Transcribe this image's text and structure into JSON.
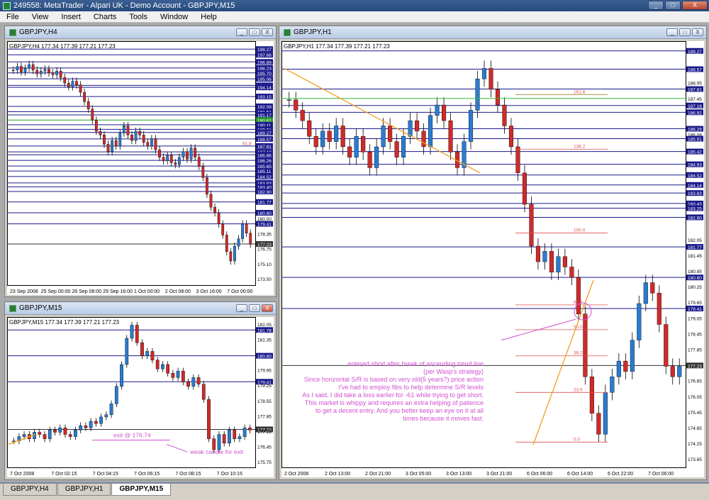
{
  "window": {
    "title": "249558: MetaTrader - Alpari UK - Demo Account - GBPJPY,M15",
    "min": "_",
    "max": "□",
    "close": "X"
  },
  "menu": [
    "File",
    "View",
    "Insert",
    "Charts",
    "Tools",
    "Window",
    "Help"
  ],
  "h4": {
    "caption": "GBPJPY,H4",
    "header": "GBPJPY,H4  177.34 177.39 177.21 177.23",
    "price_labels": [
      "198.27",
      "197.66",
      "196.89",
      "196.23",
      "195.70",
      "195.06",
      "194.35",
      "194.14",
      "193.15",
      "192.09",
      "191.51",
      "191.17",
      "190.61",
      "190.11",
      "189.61",
      "189.27",
      "188.57",
      "187.81",
      "187.18",
      "186.86",
      "186.26",
      "185.65",
      "185.11",
      "184.52",
      "183.83",
      "183.40",
      "182.90",
      "181.77",
      "180.60",
      "180.00",
      "179.41",
      "178.35",
      "177.23",
      "176.75",
      "175.10",
      "173.50"
    ],
    "fib_label": "61.8",
    "time_labels": [
      "23 Sep 2008",
      "25 Sep 00:00",
      "26 Sep 08:00",
      "29 Sep 16:00",
      "1 Oct 00:00",
      "2 Oct 08:00",
      "3 Oct 16:00",
      "7 Oct 00:00"
    ]
  },
  "m15": {
    "caption": "GBPJPY,M15",
    "header": "GBPJPY,M15  177.34 177.39 177.21 177.23",
    "price_labels": [
      "182.05",
      "181.78",
      "181.35",
      "180.65",
      "180.60",
      "179.95",
      "179.41",
      "179.25",
      "178.55",
      "177.85",
      "177.23",
      "177.15",
      "176.45",
      "175.75"
    ],
    "annotation_exit": "exit @ 176.74",
    "annotation_candle": "weak candle for exit",
    "time_labels": [
      "7 Oct 2008",
      "7 Oct 02:15",
      "7 Oct 04:15",
      "7 Oct 06:15",
      "7 Oct 08:15",
      "7 Oct 10:15"
    ]
  },
  "h1": {
    "caption": "GBPJPY,H1",
    "header": "GBPJPY,H1  177.34 177.39 177.21 177.23",
    "price_labels": [
      "189.27",
      "188.57",
      "188.05",
      "187.81",
      "187.45",
      "187.18",
      "186.92",
      "186.29",
      "186.08",
      "185.91",
      "185.42",
      "184.93",
      "184.52",
      "184.14",
      "183.83",
      "183.43",
      "183.25",
      "182.90",
      "182.05",
      "181.77",
      "181.45",
      "180.85",
      "180.60",
      "180.25",
      "179.65",
      "179.41",
      "179.05",
      "178.45",
      "177.85",
      "177.23",
      "176.65",
      "176.05",
      "175.45",
      "174.85",
      "174.25",
      "173.65"
    ],
    "fib_labels": [
      "161.8",
      "138.2",
      "100.0",
      "61.8",
      "50.0",
      "38.2",
      "23.6",
      "0.0"
    ],
    "notes": [
      "entered short after break of ascending trend line",
      "(per Wasp's strategy)",
      "Since horizontal S/R is based on very old(5 years?) price action",
      "I've had to employ fibs to help determine S/R levels",
      "As I said, I did take a loss earlier for -61 while trying to get short.",
      "This market is whippy and requires an extra helping of patience",
      "to get a decent entry. And you better keep an eye on it at all",
      "times because it moves fast."
    ],
    "time_labels": [
      "2 Oct 2008",
      "2 Oct 13:00",
      "2 Oct 21:00",
      "3 Oct 05:00",
      "3 Oct 13:00",
      "3 Oct 21:00",
      "6 Oct 06:00",
      "6 Oct 14:00",
      "6 Oct 22:00",
      "7 Oct 06:00"
    ]
  },
  "tabs": [
    "GBPJPY,H4",
    "GBPJPY,H1",
    "GBPJPY,M15"
  ],
  "colors": {
    "up": "#2a7bd0",
    "down": "#d02a2a",
    "level": "#1a1a8c",
    "fib": "#e05050",
    "trend": "#f0a020",
    "note": "#d050d0"
  }
}
